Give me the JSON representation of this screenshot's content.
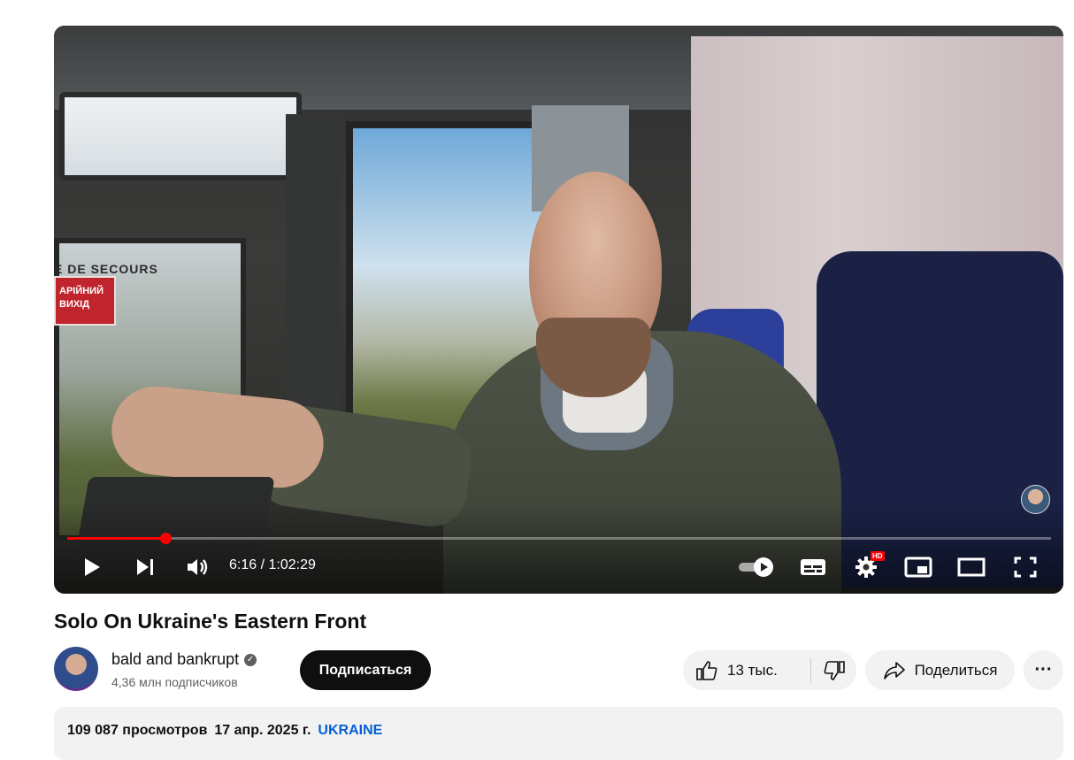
{
  "player": {
    "sign_text": "E DE SECOURS",
    "sign_label": "АРІЙНИЙ ВИХІД",
    "current_time": "6:16",
    "separator": " / ",
    "duration": "1:02:29",
    "progress_fraction": 0.1,
    "hd_badge": "HD",
    "icons": [
      "play-icon",
      "next-icon",
      "volume-icon",
      "autoplay-toggle-icon",
      "subtitles-icon",
      "settings-icon",
      "miniplayer-icon",
      "theater-icon",
      "fullscreen-icon"
    ],
    "accent_color": "#ff0000"
  },
  "video": {
    "title": "Solo On Ukraine's Eastern Front"
  },
  "channel": {
    "name": "bald and bankrupt",
    "subscribers": "4,36 млн подписчиков",
    "subscribe_label": "Подписаться"
  },
  "actions": {
    "likes": "13 тыс.",
    "share_label": "Поделиться",
    "more_label": "···"
  },
  "description": {
    "views": "109 087 просмотров",
    "date": "17 апр. 2025 г.",
    "tag": "UKRAINE",
    "tag_color": "#065fd4"
  }
}
